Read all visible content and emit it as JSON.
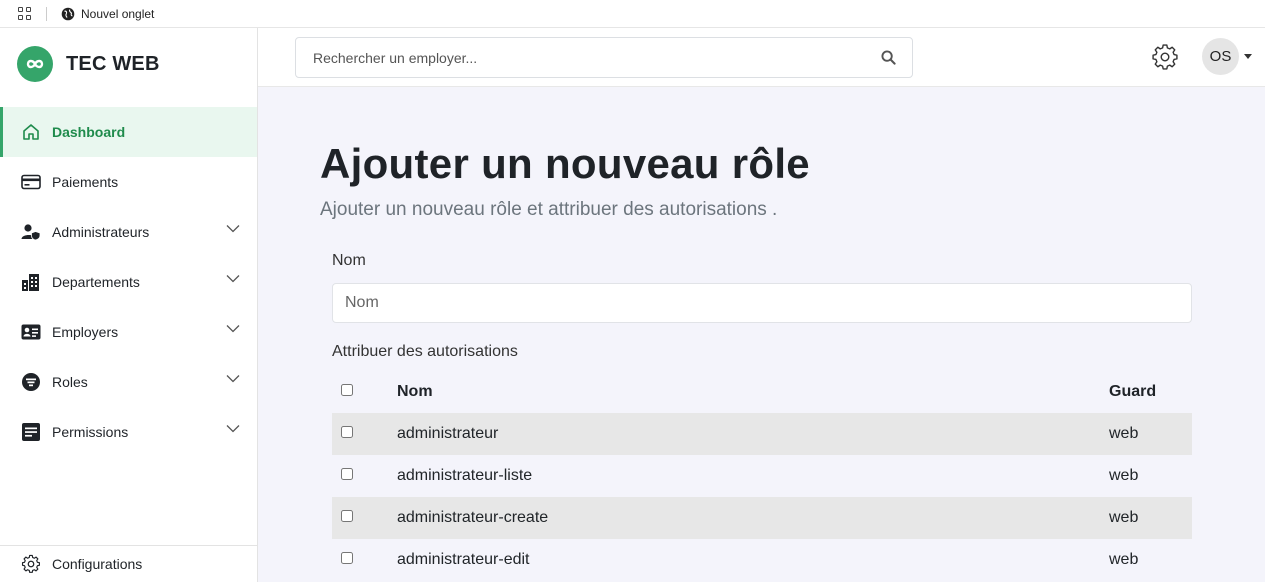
{
  "browser": {
    "tab_title": "Nouvel onglet"
  },
  "sidebar": {
    "brand_name": "TEC WEB",
    "items": [
      {
        "label": "Dashboard",
        "icon": "home-icon",
        "active": true
      },
      {
        "label": "Paiements",
        "icon": "credit-card-icon"
      },
      {
        "label": "Administrateurs",
        "icon": "user-shield-icon",
        "expandable": true
      },
      {
        "label": "Departements",
        "icon": "buildings-icon",
        "expandable": true
      },
      {
        "label": "Employers",
        "icon": "id-card-icon",
        "expandable": true
      },
      {
        "label": "Roles",
        "icon": "filter-circle-icon",
        "expandable": true
      },
      {
        "label": "Permissions",
        "icon": "list-box-icon",
        "expandable": true
      }
    ],
    "bottom_label": "Configurations"
  },
  "header": {
    "search_placeholder": "Rechercher un employer...",
    "avatar_initials": "OS"
  },
  "main": {
    "title": "Ajouter un nouveau rôle",
    "subtitle": "Ajouter un nouveau rôle et attribuer des autorisations .",
    "name_label": "Nom",
    "name_placeholder": "Nom",
    "permissions_label": "Attribuer des autorisations",
    "table": {
      "columns": [
        "Nom",
        "Guard"
      ],
      "rows": [
        {
          "name": "administrateur",
          "guard": "web"
        },
        {
          "name": "administrateur-liste",
          "guard": "web"
        },
        {
          "name": "administrateur-create",
          "guard": "web"
        },
        {
          "name": "administrateur-edit",
          "guard": "web"
        }
      ]
    }
  },
  "colors": {
    "accent": "#35a56a",
    "active_bg": "#e9f7ef",
    "main_bg": "#f4f4fb",
    "striped_row": "#e7e7e7"
  }
}
